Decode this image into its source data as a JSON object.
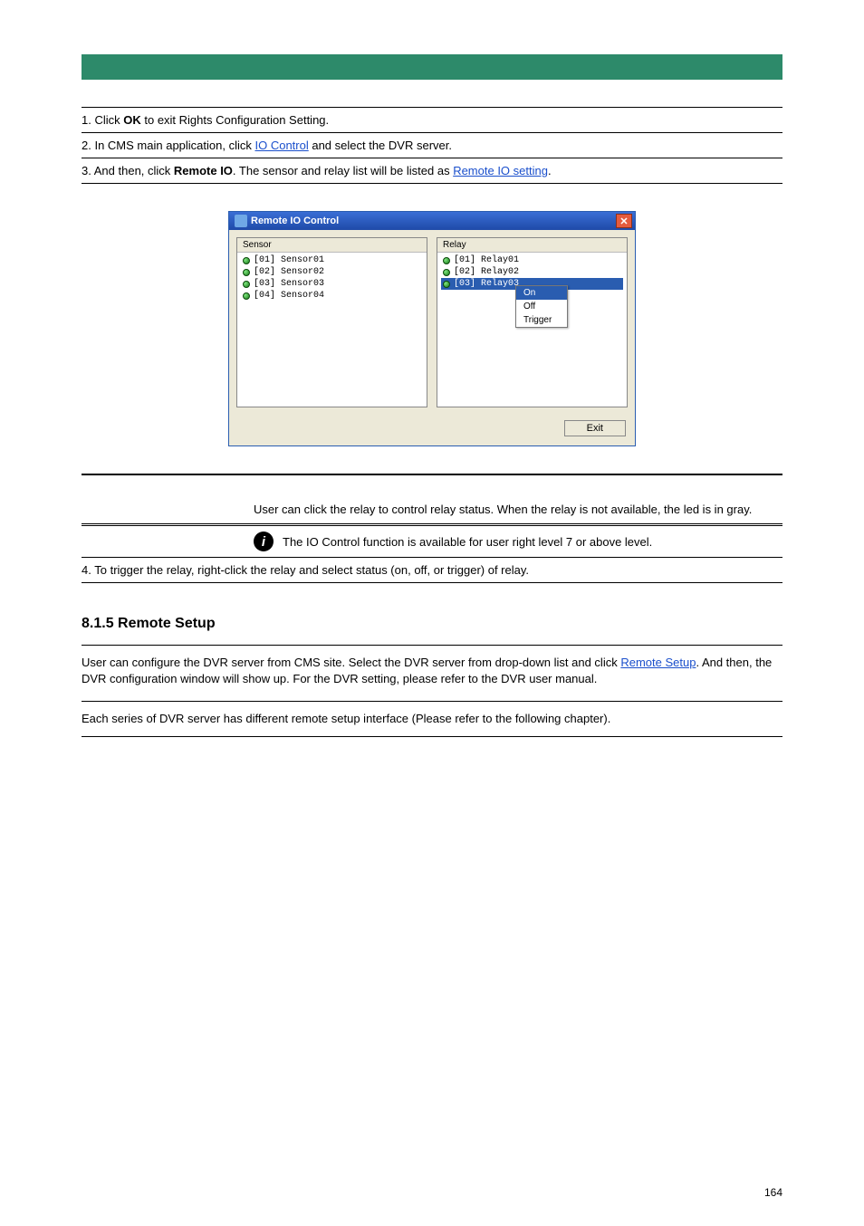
{
  "steps": {
    "s1": {
      "num": "1.",
      "text_a": "Click ",
      "btn": "OK",
      "text_b": " to exit Rights Configuration Setting."
    },
    "s2": {
      "num": "2.",
      "text_a": "In CMS main application, click ",
      "link": "IO Control",
      "text_b": " and select the DVR server."
    },
    "s3": {
      "num": "3.",
      "text_a": "And then, click ",
      "btn": "Remote IO",
      "text_b": ". The sensor and relay list will be listed as ",
      "link": "Remote IO setting",
      "text_c": "."
    }
  },
  "window": {
    "title": "Remote IO Control",
    "sensor_header": "Sensor",
    "relay_header": "Relay",
    "sensors": [
      "[01] Sensor01",
      "[02] Sensor02",
      "[03] Sensor03",
      "[04] Sensor04"
    ],
    "relays": [
      "[01] Relay01",
      "[02] Relay02",
      "[03] Relay03"
    ],
    "ctx": {
      "on": "On",
      "off": "Off",
      "trigger": "Trigger"
    },
    "exit": "Exit"
  },
  "note1": "User can click the relay to control relay status. When the relay is not available, the led is in gray.",
  "note2": "The IO Control function is available for user right level 7 or above level.",
  "step4": {
    "num": "4.",
    "text": "To trigger the relay, right-click the relay and select status (on, off, or trigger) of relay."
  },
  "section": {
    "heading": "8.1.5 Remote Setup",
    "p1_a": "User can configure the DVR server from CMS site. Select the DVR server from drop-down list and click ",
    "p1_link": "Remote Setup",
    "p1_b": ". And then, the DVR configuration window will show up. For the DVR setting, please refer to the DVR user manual.",
    "p2": "Each series of DVR server has different remote setup interface (Please refer to the following chapter)."
  },
  "page_number": "164"
}
